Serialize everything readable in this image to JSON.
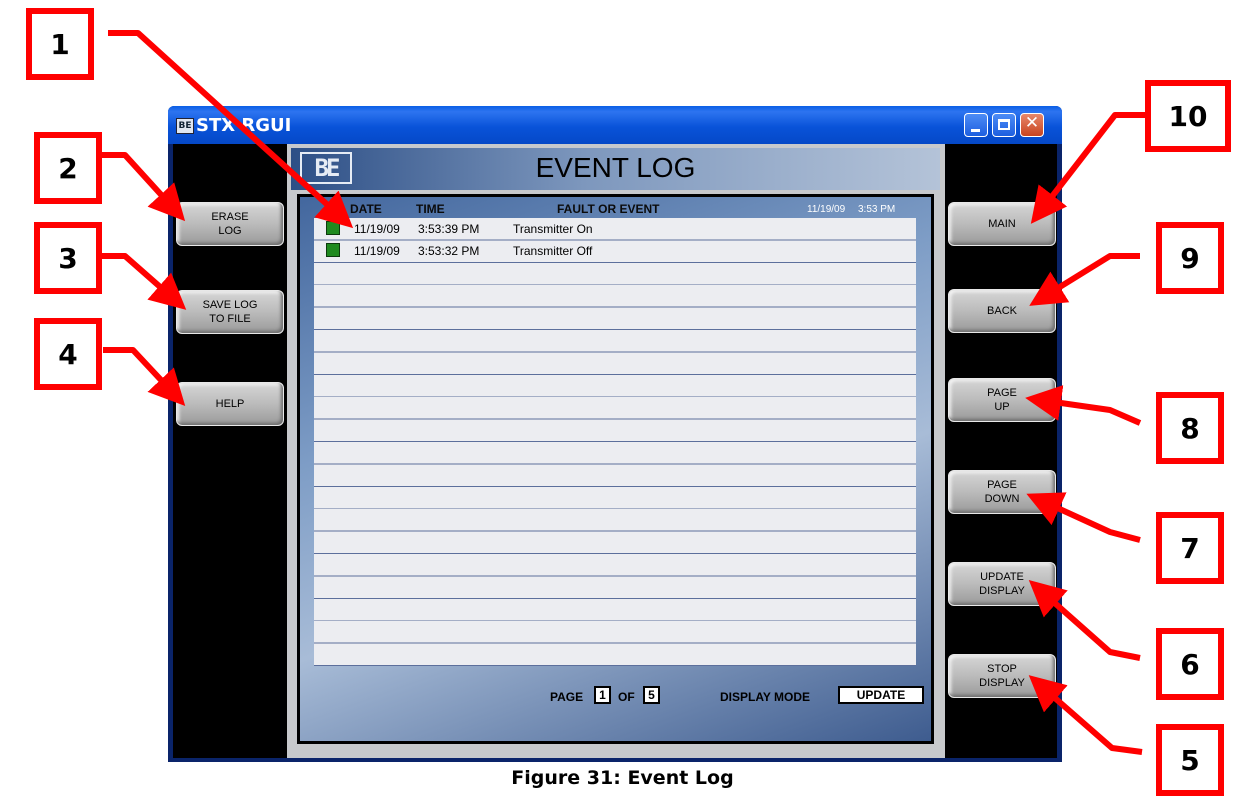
{
  "window": {
    "title": "STX RGUI",
    "icon": "app-logo-icon"
  },
  "header": {
    "logo_text": "BE",
    "title": "EVENT LOG"
  },
  "columns": {
    "date": "DATE",
    "time": "TIME",
    "fault": "FAULT OR EVENT",
    "current_date": "11/19/09",
    "current_time": "3:53 PM"
  },
  "events": [
    {
      "date": "11/19/09",
      "time": "3:53:39 PM",
      "event": "Transmitter On",
      "status_color": "#1f8a1f"
    },
    {
      "date": "11/19/09",
      "time": "3:53:32 PM",
      "event": "Transmitter Off",
      "status_color": "#1f8a1f"
    }
  ],
  "footer": {
    "page_label": "PAGE",
    "page_current": "1",
    "of_label": "OF",
    "page_total": "5",
    "display_mode_label": "DISPLAY MODE",
    "display_mode": "UPDATE"
  },
  "left_buttons": [
    {
      "label": "ERASE\nLOG"
    },
    {
      "label": "SAVE LOG\nTO FILE"
    },
    {
      "label": "HELP"
    }
  ],
  "right_buttons": [
    {
      "label": "MAIN"
    },
    {
      "label": "BACK"
    },
    {
      "label": "PAGE\nUP"
    },
    {
      "label": "PAGE\nDOWN"
    },
    {
      "label": "UPDATE\nDISPLAY"
    },
    {
      "label": "STOP\nDISPLAY"
    }
  ],
  "callouts": [
    "1",
    "2",
    "3",
    "4",
    "5",
    "6",
    "7",
    "8",
    "9",
    "10"
  ],
  "caption": "Figure 31: Event Log",
  "colors": {
    "callout_red": "#ff0000",
    "titlebar_blue": "#0a5fe6",
    "status_green": "#1f8a1f"
  }
}
